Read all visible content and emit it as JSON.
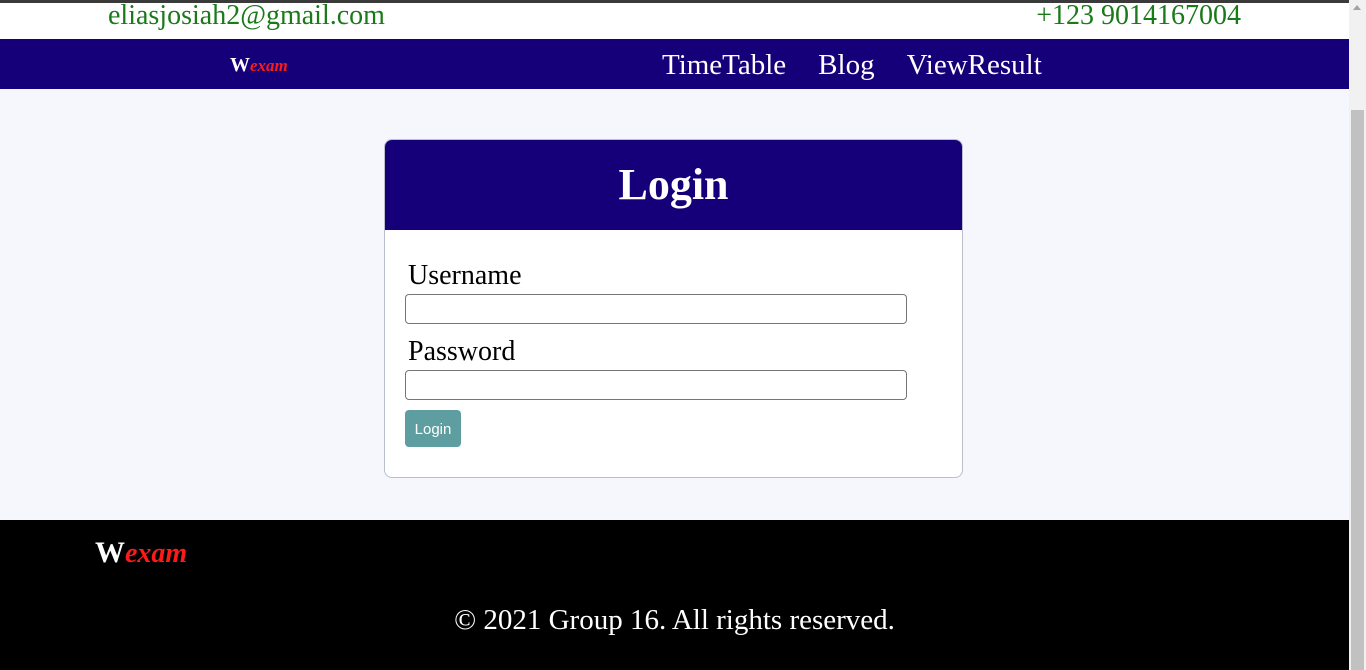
{
  "contact": {
    "email": "eliasjosiah2@gmail.com",
    "phone": "+123 9014167004"
  },
  "navbar": {
    "brand_first": "W",
    "brand_rest": "exam",
    "links": [
      "TimeTable",
      "Blog",
      "ViewResult"
    ]
  },
  "login_card": {
    "title": "Login",
    "username_label": "Username",
    "username_value": "",
    "password_label": "Password",
    "password_value": "",
    "submit_label": "Login"
  },
  "footer": {
    "brand_first": "W",
    "brand_rest": "exam",
    "copyright": "© 2021 Group 16. All rights reserved."
  },
  "colors": {
    "nav_background": "#16007a",
    "brand_accent": "#ff1a1a",
    "contact_text": "#1a7a1a",
    "button": "#5f9ea0",
    "footer_background": "#000000"
  }
}
